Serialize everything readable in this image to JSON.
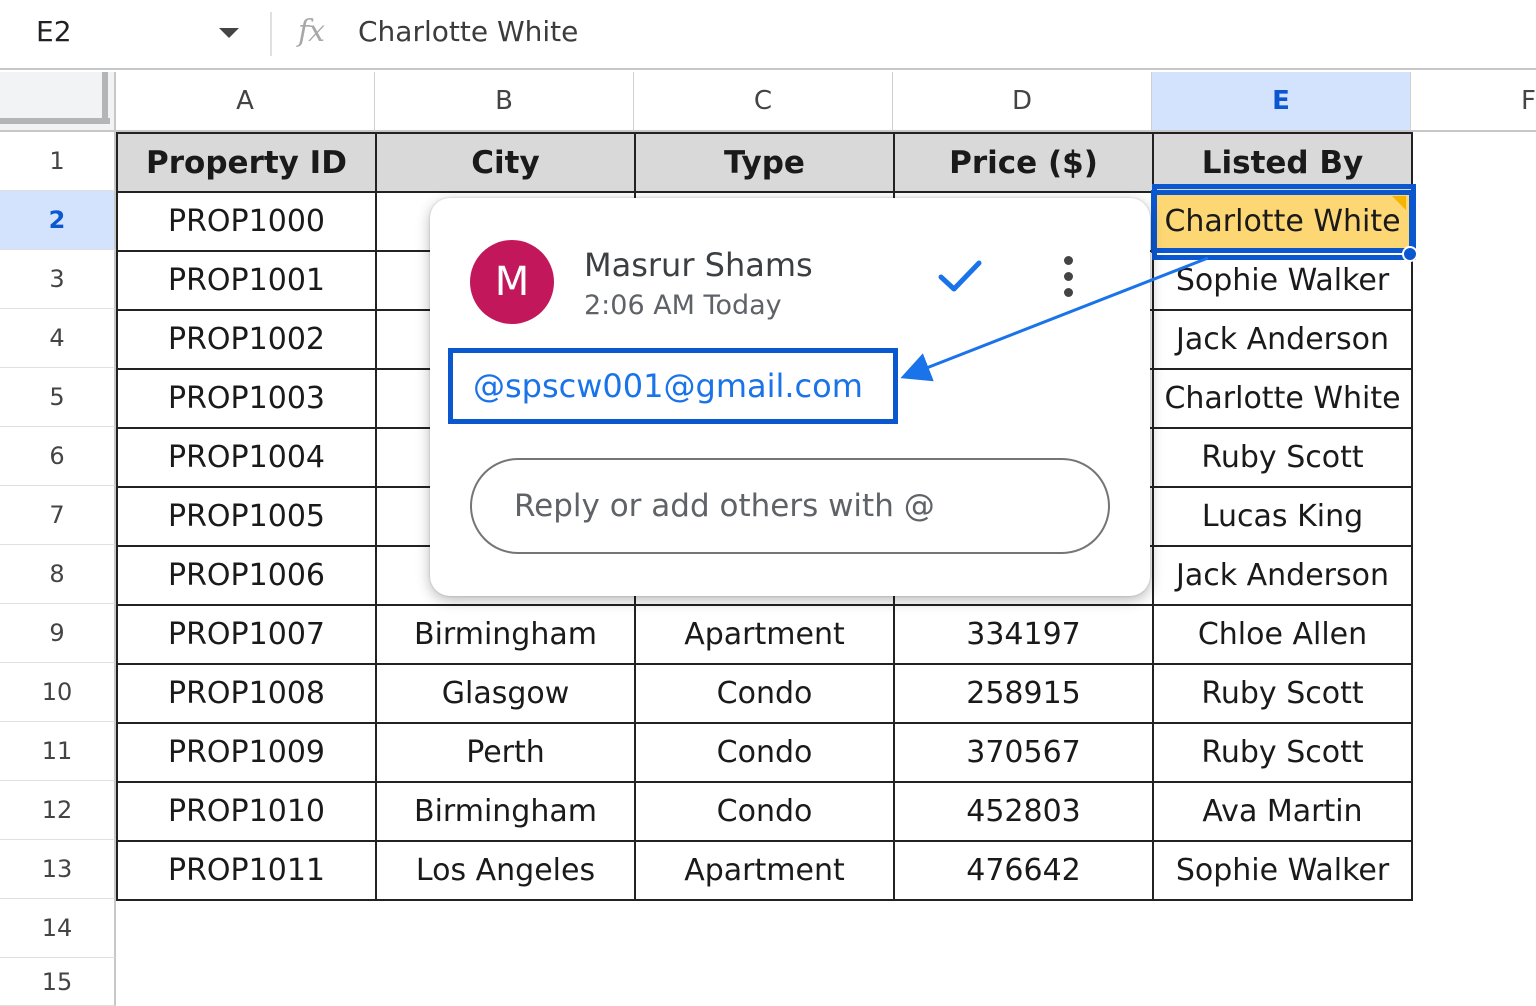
{
  "formula_bar": {
    "cell_ref": "E2",
    "fx_icon": "fx-icon",
    "content": "Charlotte White"
  },
  "columns": [
    "A",
    "B",
    "C",
    "D",
    "E",
    "F"
  ],
  "rows": [
    "1",
    "2",
    "3",
    "4",
    "5",
    "6",
    "7",
    "8",
    "9",
    "10",
    "11",
    "12",
    "13",
    "14",
    "15"
  ],
  "selected": {
    "column": "E",
    "row": "2"
  },
  "table": {
    "headers": [
      "Property ID",
      "City",
      "Type",
      "Price ($)",
      "Listed By"
    ],
    "rows": [
      [
        "PROP1000",
        "",
        "",
        "",
        "Charlotte White"
      ],
      [
        "PROP1001",
        "",
        "",
        "",
        "Sophie Walker"
      ],
      [
        "PROP1002",
        "",
        "",
        "",
        "Jack Anderson"
      ],
      [
        "PROP1003",
        "",
        "",
        "",
        "Charlotte White"
      ],
      [
        "PROP1004",
        "",
        "",
        "",
        "Ruby Scott"
      ],
      [
        "PROP1005",
        "",
        "",
        "",
        "Lucas King"
      ],
      [
        "PROP1006",
        "",
        "",
        "",
        "Jack Anderson"
      ],
      [
        "PROP1007",
        "Birmingham",
        "Apartment",
        "334197",
        "Chloe Allen"
      ],
      [
        "PROP1008",
        "Glasgow",
        "Condo",
        "258915",
        "Ruby Scott"
      ],
      [
        "PROP1009",
        "Perth",
        "Condo",
        "370567",
        "Ruby Scott"
      ],
      [
        "PROP1010",
        "Birmingham",
        "Condo",
        "452803",
        "Ava Martin"
      ],
      [
        "PROP1011",
        "Los Angeles",
        "Apartment",
        "476642",
        "Sophie Walker"
      ]
    ]
  },
  "comment": {
    "avatar_letter": "M",
    "author": "Masrur Shams",
    "time": "2:06 AM Today",
    "mention": "@spscw001@gmail.com",
    "reply_placeholder": "Reply or add others with @",
    "resolve_icon": "checkmark-icon",
    "more_icon": "more-vert-icon"
  },
  "colors": {
    "selection": "#0b57d0",
    "selected_fill": "#fdd774",
    "header_fill": "#d9d9d9",
    "avatar": "#c2185b",
    "mention": "#1a73e8"
  }
}
